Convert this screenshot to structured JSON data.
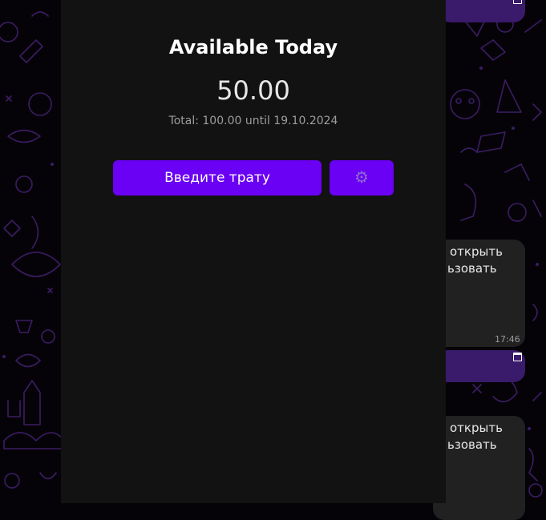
{
  "app": {
    "title": "Available Today",
    "available_amount": "50.00",
    "total_line": "Total: 100.00 until 19.10.2024",
    "spend_button_label": "Введите трату",
    "settings_icon": "gear-icon"
  },
  "chat_background": {
    "messages": [
      {
        "line1": "открыть",
        "line2": "ьзовать",
        "time": "17:46"
      },
      {
        "line1": "открыть",
        "line2": "ьзовать",
        "time": ""
      }
    ]
  },
  "colors": {
    "accent": "#6a00f4",
    "modal_background": "#121212",
    "chat_purple": "#3a1a6b"
  }
}
